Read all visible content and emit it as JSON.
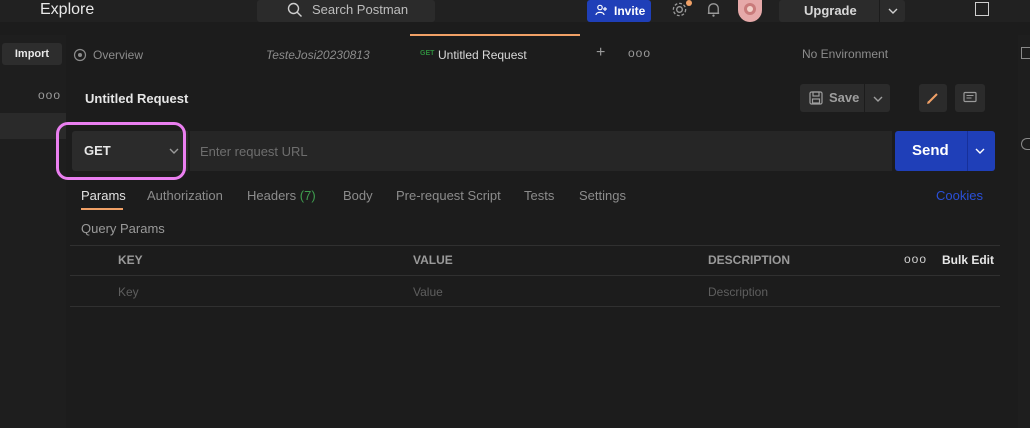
{
  "header": {
    "explore_label": "Explore",
    "search_placeholder": "Search Postman",
    "invite_label": "Invite",
    "upgrade_label": "Upgrade"
  },
  "sidebar": {
    "import_label": "Import",
    "more_label": "ooo"
  },
  "tabs": {
    "overview_label": "Overview",
    "workspace_tab_label": "TesteJosi20230813",
    "active_tab_method": "GET",
    "active_tab_label": "Untitled Request",
    "add_label": "+",
    "more_label": "ooo",
    "environment_label": "No Environment"
  },
  "request": {
    "title": "Untitled Request",
    "save_label": "Save",
    "method": "GET",
    "url_placeholder": "Enter request URL",
    "url_value": "",
    "send_label": "Send"
  },
  "request_tabs": {
    "params": "Params",
    "authorization": "Authorization",
    "headers": "Headers",
    "headers_count": "(7)",
    "body": "Body",
    "pre_request_script": "Pre-request Script",
    "tests": "Tests",
    "settings": "Settings",
    "cookies": "Cookies"
  },
  "params": {
    "section_title": "Query Params",
    "columns": {
      "key": "KEY",
      "value": "VALUE",
      "description": "DESCRIPTION"
    },
    "more_label": "ooo",
    "bulk_edit_label": "Bulk Edit",
    "row_placeholders": {
      "key": "Key",
      "value": "Value",
      "description": "Description"
    }
  },
  "colors": {
    "accent_orange": "#f0a066",
    "primary_blue": "#1f3fb8",
    "highlight_pink": "#ea7ff0",
    "headers_count_green": "#3f9e4f",
    "link_blue": "#2a50d8"
  }
}
